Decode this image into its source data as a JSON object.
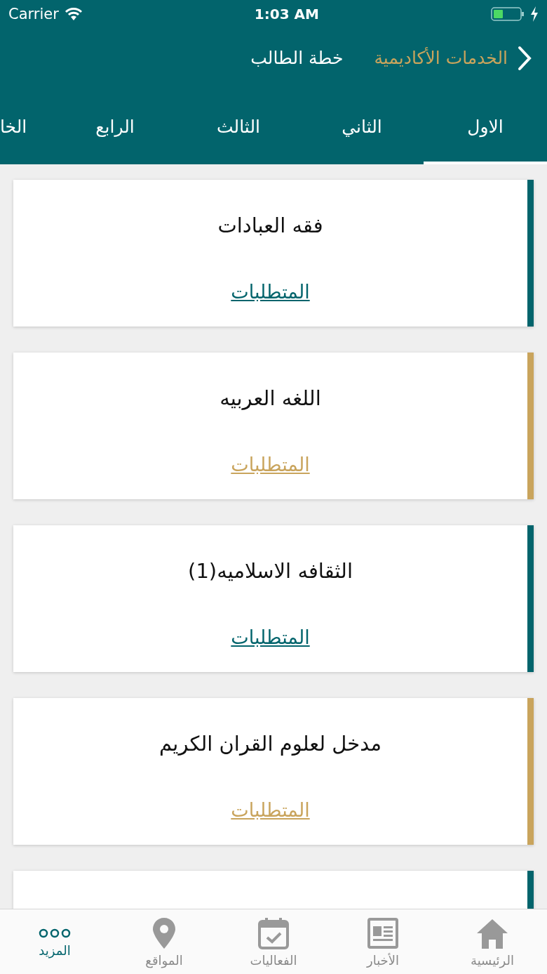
{
  "status_bar": {
    "carrier": "Carrier",
    "time": "1:03 AM"
  },
  "nav": {
    "back_label": "الخدمات الأكاديمية",
    "title": "خطة الطالب"
  },
  "tabs": [
    {
      "label": "الاول",
      "selected": true
    },
    {
      "label": "الثاني",
      "selected": false
    },
    {
      "label": "الثالث",
      "selected": false
    },
    {
      "label": "الرابع",
      "selected": false
    },
    {
      "label": "الخا",
      "selected": false
    }
  ],
  "courses": [
    {
      "title": "فقه العبادات",
      "link": "المتطلبات",
      "color": "#02646c"
    },
    {
      "title": "اللغه العربيه",
      "link": "المتطلبات",
      "color": "#c9a45c"
    },
    {
      "title": "الثقافه الاسلاميه(1)",
      "link": "المتطلبات",
      "color": "#02646c"
    },
    {
      "title": "مدخل لعلوم القران الكريم",
      "link": "المتطلبات",
      "color": "#c9a45c"
    },
    {
      "color": "#02646c"
    }
  ],
  "tab_bar": [
    {
      "label": "الرئيسية",
      "kind": "home",
      "selected": false
    },
    {
      "label": "الأخبار",
      "kind": "news",
      "selected": false
    },
    {
      "label": "الفعاليات",
      "kind": "calendar",
      "selected": false
    },
    {
      "label": "المواقع",
      "kind": "pin",
      "selected": false
    },
    {
      "label": "المزيد",
      "kind": "more",
      "selected": true
    }
  ]
}
